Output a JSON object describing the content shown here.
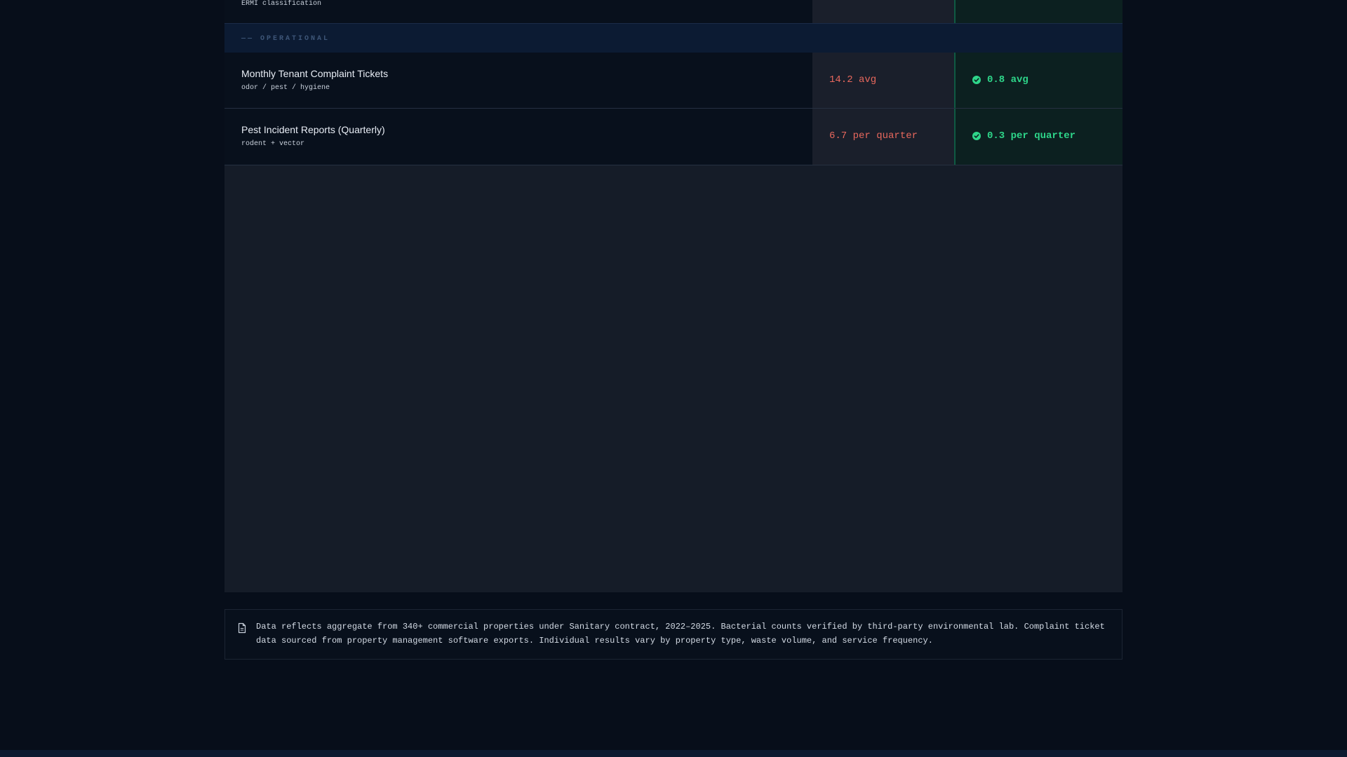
{
  "top_row": {
    "sublabel": "ERMI classification"
  },
  "section": {
    "label": "—— OPERATIONAL"
  },
  "rows": [
    {
      "title": "Monthly Tenant Complaint Tickets",
      "sublabel": "odor / pest / hygiene",
      "before": "14.2 avg",
      "after": "0.8 avg"
    },
    {
      "title": "Pest Incident Reports (Quarterly)",
      "sublabel": "rodent + vector",
      "before": "6.7 per quarter",
      "after": "0.3 per quarter"
    }
  ],
  "footnote": {
    "icon": "document-icon",
    "text": "Data reflects aggregate from 340+ commercial properties under Sanitary contract, 2022–2025. Bacterial counts verified by third-party environmental lab. Complaint ticket data sourced from property management software exports. Individual results vary by property type, waste volume, and service frequency."
  },
  "colors": {
    "page_bg": "#070e1a",
    "before_value": "#e8685d",
    "after_value": "#2ed68a",
    "section_header_bg": "#0c1b33"
  }
}
